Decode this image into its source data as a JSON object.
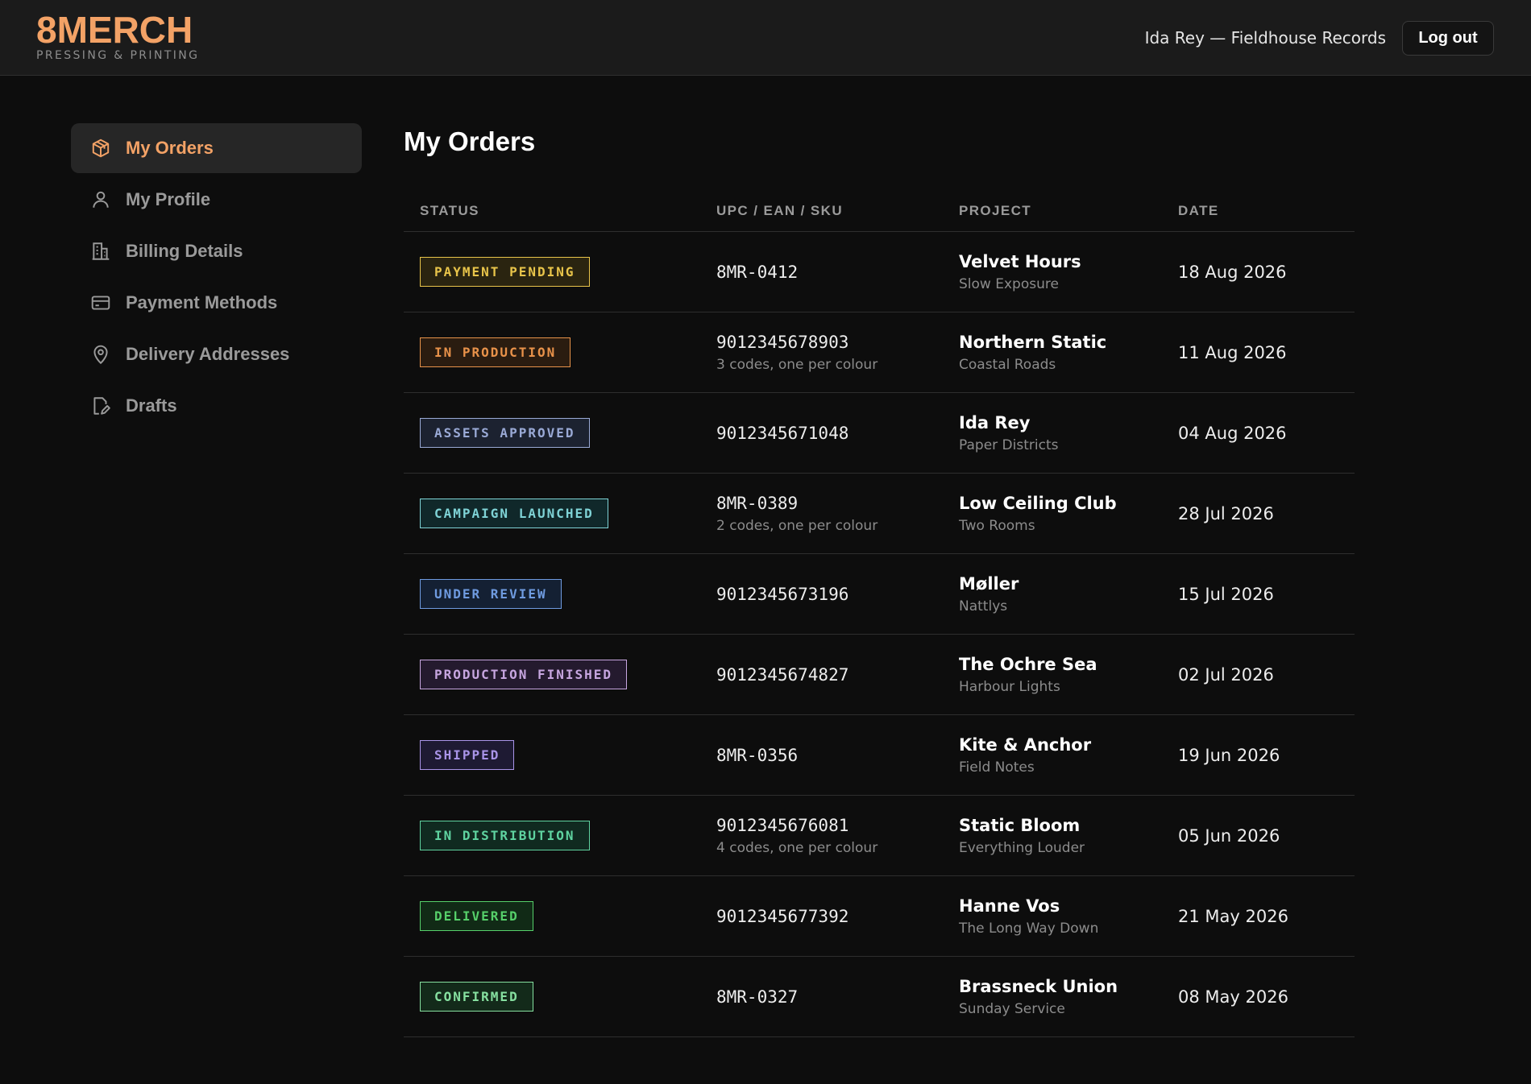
{
  "brand": {
    "logo": "8MERCH",
    "tagline": "PRESSING & PRINTING",
    "accent": "#f3a266"
  },
  "header": {
    "user": "Ida Rey — Fieldhouse Records",
    "logout_label": "Log out"
  },
  "sidebar": {
    "items": [
      {
        "label": "My Orders",
        "icon": "package-icon",
        "active": true
      },
      {
        "label": "My Profile",
        "icon": "user-icon"
      },
      {
        "label": "Billing Details",
        "icon": "building-icon"
      },
      {
        "label": "Payment Methods",
        "icon": "credit-card-icon"
      },
      {
        "label": "Delivery Addresses",
        "icon": "map-pin-icon"
      },
      {
        "label": "Drafts",
        "icon": "draft-file-icon"
      }
    ]
  },
  "main": {
    "title": "My Orders",
    "columns": [
      "STATUS",
      "UPC / EAN / SKU",
      "PROJECT",
      "DATE"
    ],
    "orders": [
      {
        "status": "PAYMENT PENDING",
        "color": "#e8c44a",
        "bg": "#2a2410",
        "code": "8MR-0412",
        "note": "",
        "project": "Velvet Hours",
        "artist": "Slow Exposure",
        "date": "18 Aug 2026"
      },
      {
        "status": "IN PRODUCTION",
        "color": "#e8924a",
        "bg": "#2a1c10",
        "code": "9012345678903",
        "note": "3 codes, one per colour",
        "project": "Northern Static",
        "artist": "Coastal Roads",
        "date": "11 Aug 2026"
      },
      {
        "status": "ASSETS APPROVED",
        "color": "#9aaad6",
        "bg": "#1c2230",
        "code": "9012345671048",
        "note": "",
        "project": "Ida Rey",
        "artist": "Paper Districts",
        "date": "04 Aug 2026"
      },
      {
        "status": "CAMPAIGN LAUNCHED",
        "color": "#7fd3d6",
        "bg": "#10282a",
        "code": "8MR-0389",
        "note": "2 codes, one per colour",
        "project": "Low Ceiling Club",
        "artist": "Two Rooms",
        "date": "28 Jul 2026"
      },
      {
        "status": "UNDER REVIEW",
        "color": "#6f9be0",
        "bg": "#142033",
        "code": "9012345673196",
        "note": "",
        "project": "Møller",
        "artist": "Nattlys",
        "date": "15 Jul 2026"
      },
      {
        "status": "PRODUCTION FINISHED",
        "color": "#c7a6e0",
        "bg": "#241a2e",
        "code": "9012345674827",
        "note": "",
        "project": "The Ochre Sea",
        "artist": "Harbour Lights",
        "date": "02 Jul 2026"
      },
      {
        "status": "SHIPPED",
        "color": "#a994e8",
        "bg": "#1e1a33",
        "code": "8MR-0356",
        "note": "",
        "project": "Kite & Anchor",
        "artist": "Field Notes",
        "date": "19 Jun 2026"
      },
      {
        "status": "IN DISTRIBUTION",
        "color": "#5fd3a0",
        "bg": "#102a20",
        "code": "9012345676081",
        "note": "4 codes, one per colour",
        "project": "Static Bloom",
        "artist": "Everything Louder",
        "date": "05 Jun 2026"
      },
      {
        "status": "DELIVERED",
        "color": "#56d06a",
        "bg": "#112a16",
        "code": "9012345677392",
        "note": "",
        "project": "Hanne Vos",
        "artist": "The Long Way Down",
        "date": "21 May 2026"
      },
      {
        "status": "CONFIRMED",
        "color": "#86e0a0",
        "bg": "#132a1a",
        "code": "8MR-0327",
        "note": "",
        "project": "Brassneck Union",
        "artist": "Sunday Service",
        "date": "08 May 2026"
      }
    ]
  }
}
